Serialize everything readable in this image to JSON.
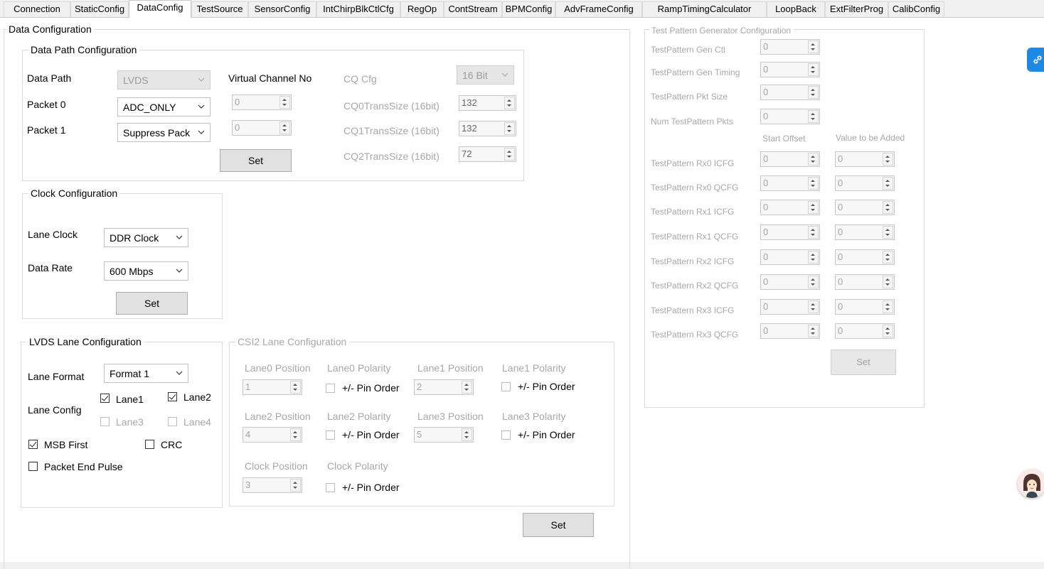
{
  "tabs": [
    "Connection",
    "StaticConfig",
    "DataConfig",
    "TestSource",
    "SensorConfig",
    "IntChirpBlkCtlCfg",
    "RegOp",
    "ContStream",
    "BPMConfig",
    "AdvFrameConfig",
    "RampTimingCalculator",
    "LoopBack",
    "ExtFilterProg",
    "CalibConfig"
  ],
  "active_tab": "DataConfig",
  "data_config": {
    "title": "Data Configuration",
    "data_path": {
      "title": "Data Path Configuration",
      "data_path_label": "Data Path",
      "data_path_value": "LVDS",
      "packet0_label": "Packet 0",
      "packet0_value": "ADC_ONLY",
      "packet1_label": "Packet 1",
      "packet1_value": "Suppress Pack",
      "virtual_channel_label": "Virtual Channel No",
      "vc0_value": "0",
      "vc1_value": "0",
      "set_label": "Set",
      "cq_cfg_label": "CQ Cfg",
      "cq_cfg_value": "16 Bit",
      "cq0_label": "CQ0TransSize (16bit)",
      "cq0_value": "132",
      "cq1_label": "CQ1TransSize (16bit)",
      "cq1_value": "132",
      "cq2_label": "CQ2TransSize (16bit)",
      "cq2_value": "72"
    },
    "clock": {
      "title": "Clock Configuration",
      "lane_clock_label": "Lane Clock",
      "lane_clock_value": "DDR Clock",
      "data_rate_label": "Data Rate",
      "data_rate_value": "600 Mbps",
      "set_label": "Set"
    },
    "lvds_lane": {
      "title": "LVDS Lane Configuration",
      "lane_format_label": "Lane Format",
      "lane_format_value": "Format 1",
      "lane_config_label": "Lane Config",
      "lane1": "Lane1",
      "lane2": "Lane2",
      "lane3": "Lane3",
      "lane4": "Lane4",
      "msb_first": "MSB First",
      "crc": "CRC",
      "packet_end_pulse": "Packet End Pulse"
    },
    "csi2_lane": {
      "title": "CSI2 Lane Configuration",
      "lane0_position": "Lane0 Position",
      "lane0_polarity": "Lane0 Polarity",
      "lane1_position": "Lane1 Position",
      "lane1_polarity": "Lane1 Polarity",
      "lane2_position": "Lane2 Position",
      "lane2_polarity": "Lane2 Polarity",
      "lane3_position": "Lane3 Position",
      "lane3_polarity": "Lane3 Polarity",
      "clock_position": "Clock Position",
      "clock_polarity": "Clock Polarity",
      "pin_order": "+/- Pin Order",
      "lane0_value": "1",
      "lane1_value": "2",
      "lane2_value": "4",
      "lane3_value": "5",
      "clock_value": "3"
    },
    "set_label": "Set"
  },
  "test_pattern": {
    "title": "Test Pattern Generator Configuration",
    "gen_ctl_label": "TestPattern Gen Ctl",
    "gen_ctl_value": "0",
    "gen_timing_label": "TestPattern Gen Timing",
    "gen_timing_value": "0",
    "pkt_size_label": "TestPattern Pkt Size",
    "pkt_size_value": "0",
    "num_pkts_label": "Num TestPattern Pkts",
    "num_pkts_value": "0",
    "start_offset_label": "Start Offset",
    "value_added_label": "Value to be Added",
    "rows": [
      {
        "label": "TestPattern Rx0 ICFG",
        "offset": "0",
        "added": "0"
      },
      {
        "label": "TestPattern Rx0 QCFG",
        "offset": "0",
        "added": "0"
      },
      {
        "label": "TestPattern Rx1 ICFG",
        "offset": "0",
        "added": "0"
      },
      {
        "label": "TestPattern Rx1 QCFG",
        "offset": "0",
        "added": "0"
      },
      {
        "label": "TestPattern Rx2 ICFG",
        "offset": "0",
        "added": "0"
      },
      {
        "label": "TestPattern Rx2 QCFG",
        "offset": "0",
        "added": "0"
      },
      {
        "label": "TestPattern Rx3 ICFG",
        "offset": "0",
        "added": "0"
      },
      {
        "label": "TestPattern Rx3 QCFG",
        "offset": "0",
        "added": "0"
      }
    ],
    "set_label": "Set"
  },
  "colors": {
    "accent": "#1e88e5",
    "disabled_text": "#a8a8a8"
  },
  "icons": [
    "link-icon",
    "assistant-avatar-icon"
  ]
}
